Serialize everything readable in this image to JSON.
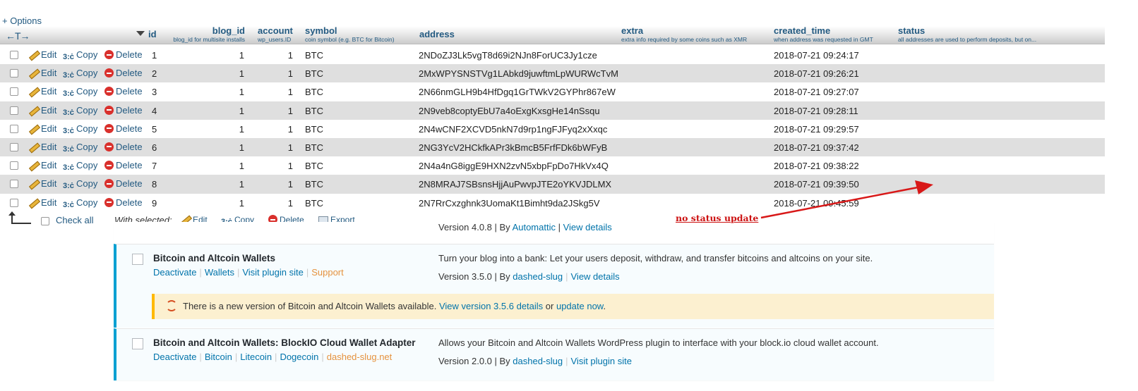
{
  "options_link": "+ Options",
  "columns": {
    "arrows": "←T→",
    "id": {
      "title": "id"
    },
    "blog_id": {
      "title": "blog_id",
      "comment": "blog_id for multisite installs"
    },
    "account": {
      "title": "account",
      "comment": "wp_users.ID"
    },
    "symbol": {
      "title": "symbol",
      "comment": "coin symbol (e.g. BTC for Bitcoin)"
    },
    "address": {
      "title": "address"
    },
    "extra": {
      "title": "extra",
      "comment": "extra info required by some coins such as XMR"
    },
    "created_time": {
      "title": "created_time",
      "comment": "when address was requested in GMT"
    },
    "status": {
      "title": "status",
      "comment": "all addresses are used to perform deposits, but on..."
    }
  },
  "row_actions": {
    "edit": "Edit",
    "copy": "Copy",
    "delete": "Delete"
  },
  "rows": [
    {
      "id": "1",
      "blog_id": "1",
      "account": "1",
      "symbol": "BTC",
      "address": "2NDoZJ3Lk5vgT8d69i2NJn8ForUC3Jy1cze",
      "created_time": "2018-07-21 09:24:17"
    },
    {
      "id": "2",
      "blog_id": "1",
      "account": "1",
      "symbol": "BTC",
      "address": "2MxWPYSNSTVg1LAbkd9juwftmLpWURWcTvM",
      "created_time": "2018-07-21 09:26:21"
    },
    {
      "id": "3",
      "blog_id": "1",
      "account": "1",
      "symbol": "BTC",
      "address": "2N66nmGLH9b4HfDgq1GrTWkV2GYPhr867eW",
      "created_time": "2018-07-21 09:27:07"
    },
    {
      "id": "4",
      "blog_id": "1",
      "account": "1",
      "symbol": "BTC",
      "address": "2N9veb8coptyEbU7a4oExgKxsgHe14nSsqu",
      "created_time": "2018-07-21 09:28:11"
    },
    {
      "id": "5",
      "blog_id": "1",
      "account": "1",
      "symbol": "BTC",
      "address": "2N4wCNF2XCVD5nkN7d9rp1ngFJFyq2xXxqc",
      "created_time": "2018-07-21 09:29:57"
    },
    {
      "id": "6",
      "blog_id": "1",
      "account": "1",
      "symbol": "BTC",
      "address": "2NG3YcV2HCkfkAPr3kBmcB5FrfFDk6bWFyB",
      "created_time": "2018-07-21 09:37:42"
    },
    {
      "id": "7",
      "blog_id": "1",
      "account": "1",
      "symbol": "BTC",
      "address": "2N4a4nG8iggE9HXN2zvN5xbpFpDo7HkVx4Q",
      "created_time": "2018-07-21 09:38:22"
    },
    {
      "id": "8",
      "blog_id": "1",
      "account": "1",
      "symbol": "BTC",
      "address": "2N8MRAJ7SBsnsHjjAuPwvpJTE2oYKVJDLMX",
      "created_time": "2018-07-21 09:39:50"
    },
    {
      "id": "9",
      "blog_id": "1",
      "account": "1",
      "symbol": "BTC",
      "address": "2N7RrCxzghnk3UomaKt1Bimht9da2JSkg5V",
      "created_time": "2018-07-21 09:45:59"
    }
  ],
  "footer": {
    "check_all": "Check all",
    "with_selected": "With selected:",
    "edit": "Edit",
    "copy": "Copy",
    "delete": "Delete",
    "export": "Export"
  },
  "annotation": {
    "text": "no status update",
    "color": "#cc1111"
  },
  "wp": {
    "partial_version": {
      "prefix": "Version 4.0.8 | By ",
      "author": "Automattic",
      "sep": " | ",
      "details": "View details"
    },
    "plugins": [
      {
        "name": "Bitcoin and Altcoin Wallets",
        "links": [
          "Deactivate",
          "Wallets",
          "Visit plugin site",
          "Support"
        ],
        "description": "Turn your blog into a bank: Let your users deposit, withdraw, and transfer bitcoins and altcoins on your site.",
        "version": "Version 3.5.0 | By ",
        "author": "dashed-slug",
        "details": "View details",
        "update": {
          "text": "There is a new version of Bitcoin and Altcoin Wallets available. ",
          "link1": "View version 3.5.6 details",
          "or": " or ",
          "link2": "update now",
          "end": "."
        }
      },
      {
        "name": "Bitcoin and Altcoin Wallets: BlockIO Cloud Wallet Adapter",
        "links": [
          "Deactivate",
          "Bitcoin",
          "Litecoin",
          "Dogecoin",
          "dashed-slug.net"
        ],
        "description": "Allows your Bitcoin and Altcoin Wallets WordPress plugin to interface with your block.io cloud wallet account.",
        "version": "Version 2.0.0 | By ",
        "author": "dashed-slug",
        "details": "Visit plugin site"
      }
    ]
  },
  "colors": {
    "link": "#235a81",
    "wp_link": "#0073aa",
    "wp_accent": "#00a0d2",
    "update_bg": "#fcf0d0",
    "arrow": "#d81818"
  }
}
